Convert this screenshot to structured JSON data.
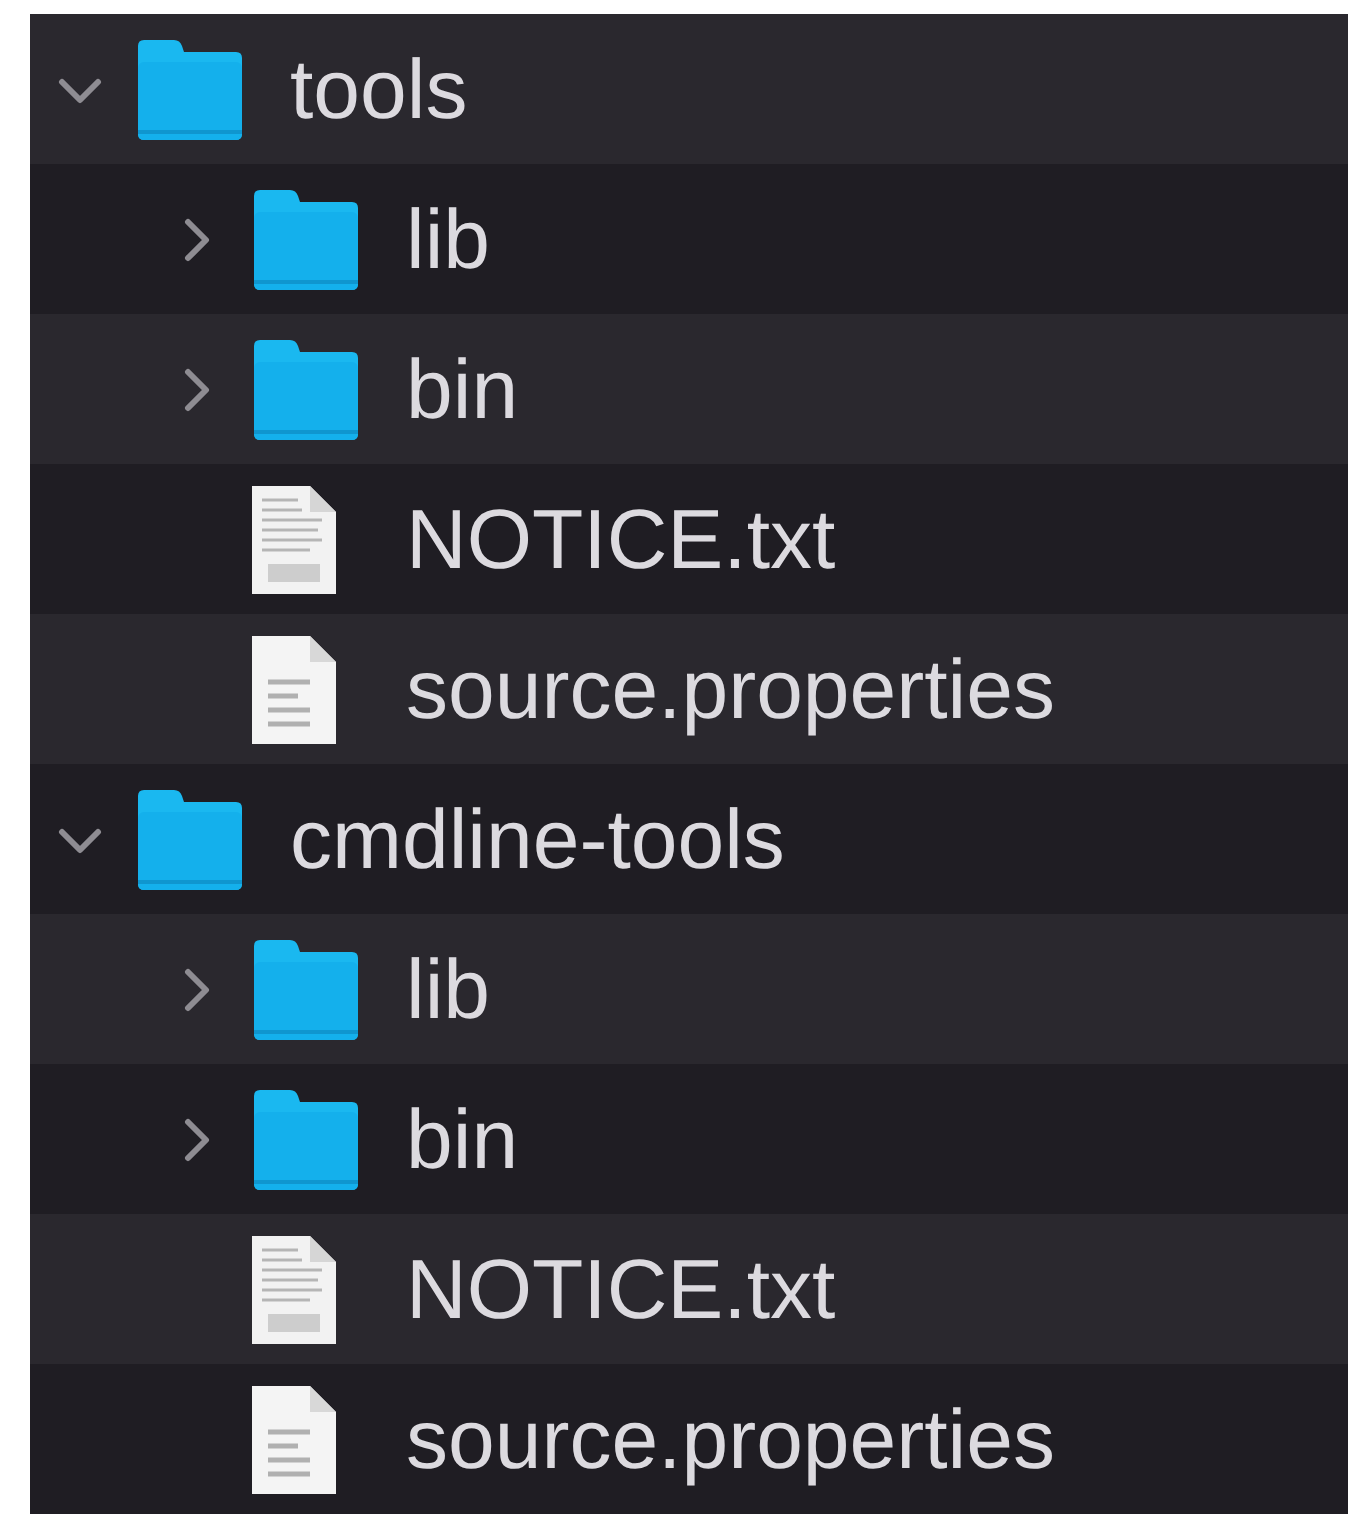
{
  "tree": [
    {
      "name": "tools",
      "kind": "folder",
      "expanded": true,
      "children": [
        {
          "name": "lib",
          "kind": "folder",
          "expanded": false
        },
        {
          "name": "bin",
          "kind": "folder",
          "expanded": false
        },
        {
          "name": "NOTICE.txt",
          "kind": "txt"
        },
        {
          "name": "source.properties",
          "kind": "doc"
        }
      ]
    },
    {
      "name": "cmdline-tools",
      "kind": "folder",
      "expanded": true,
      "children": [
        {
          "name": "lib",
          "kind": "folder",
          "expanded": false
        },
        {
          "name": "bin",
          "kind": "folder",
          "expanded": false
        },
        {
          "name": "NOTICE.txt",
          "kind": "txt"
        },
        {
          "name": "source.properties",
          "kind": "doc"
        }
      ]
    }
  ]
}
